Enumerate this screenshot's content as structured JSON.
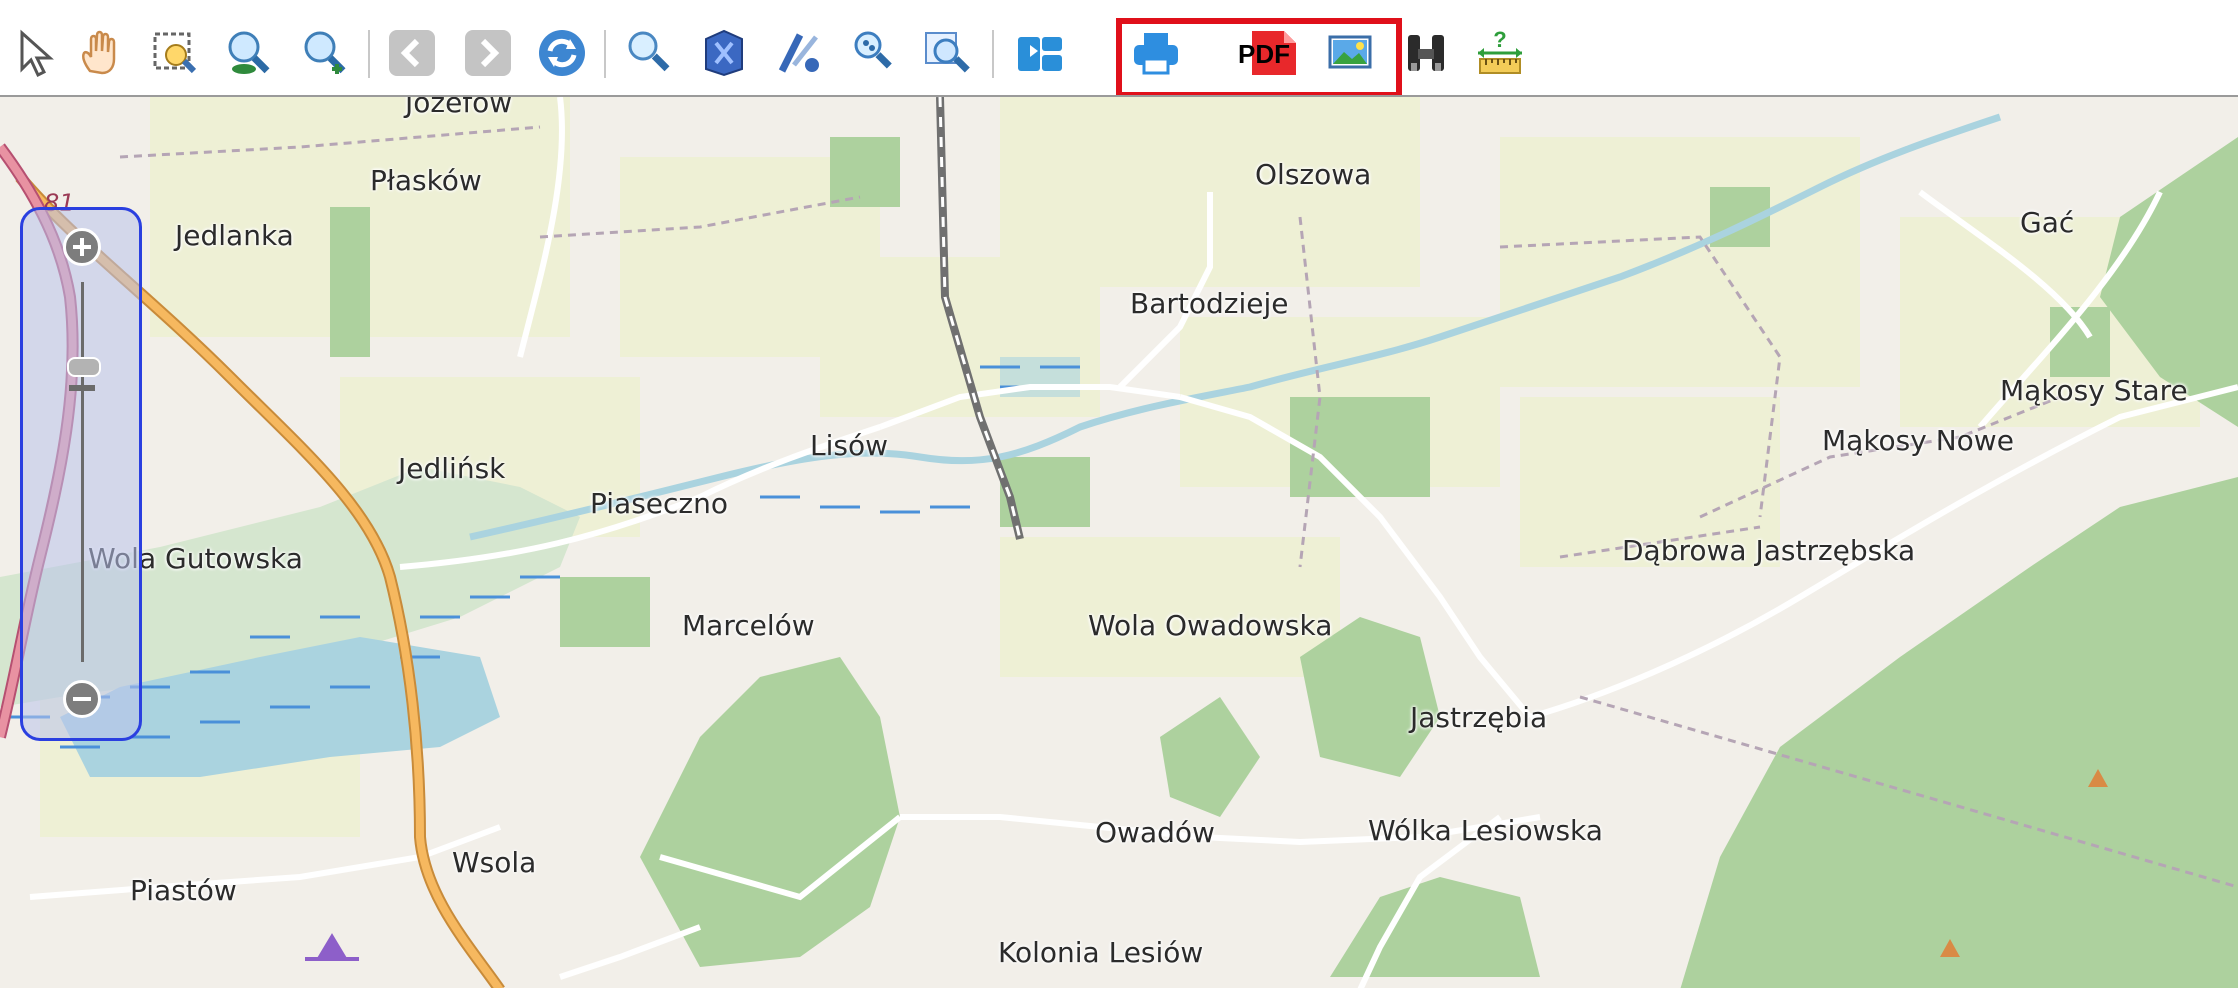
{
  "toolbar": {
    "tools": [
      {
        "name": "select-arrow-icon"
      },
      {
        "name": "pan-hand-icon"
      },
      {
        "name": "zoom-box-icon"
      },
      {
        "name": "zoom-out-icon"
      },
      {
        "name": "zoom-in-icon"
      },
      {
        "name": "back-arrow-icon"
      },
      {
        "name": "forward-arrow-icon"
      },
      {
        "name": "refresh-icon"
      },
      {
        "name": "search-icon"
      },
      {
        "name": "zoom-to-layer-icon"
      },
      {
        "name": "zoom-to-extent-icon"
      },
      {
        "name": "zoom-selection-icon"
      },
      {
        "name": "zoom-previous-icon"
      },
      {
        "name": "layers-icon"
      },
      {
        "name": "print-icon"
      },
      {
        "name": "pdf-export-icon"
      },
      {
        "name": "image-export-icon"
      },
      {
        "name": "binoculars-icon"
      },
      {
        "name": "measure-icon"
      }
    ],
    "pdf_label": "PDF",
    "help_mark": "?",
    "highlight_color": "#e0101a"
  },
  "map": {
    "road_number": "81",
    "places": [
      {
        "name": "Józefów"
      },
      {
        "name": "Płasków"
      },
      {
        "name": "Jedlanka"
      },
      {
        "name": "Olszowa"
      },
      {
        "name": "Gać"
      },
      {
        "name": "Bartodzieje"
      },
      {
        "name": "Mąkosy Stare"
      },
      {
        "name": "Mąkosy Nowe"
      },
      {
        "name": "Lisów"
      },
      {
        "name": "Jedlińsk"
      },
      {
        "name": "Piaseczno"
      },
      {
        "name": "Dąbrowa Jastrzębska"
      },
      {
        "name": "Wola Gutowska"
      },
      {
        "name": "Marcelów"
      },
      {
        "name": "Wola Owadowska"
      },
      {
        "name": "Jastrzębia"
      },
      {
        "name": "Owadów"
      },
      {
        "name": "Wólka Lesiowska"
      },
      {
        "name": "Piastów"
      },
      {
        "name": "Wsola"
      },
      {
        "name": "Kolonia Lesiów"
      }
    ],
    "colors": {
      "land": "#f2efe9",
      "farmland": "#eef0d5",
      "forest": "#add19e",
      "water": "#aad3df",
      "main_road": "#f6b85f"
    }
  },
  "zoom_control": {
    "zoom_in": "+",
    "zoom_out": "−",
    "level": 0.28
  }
}
